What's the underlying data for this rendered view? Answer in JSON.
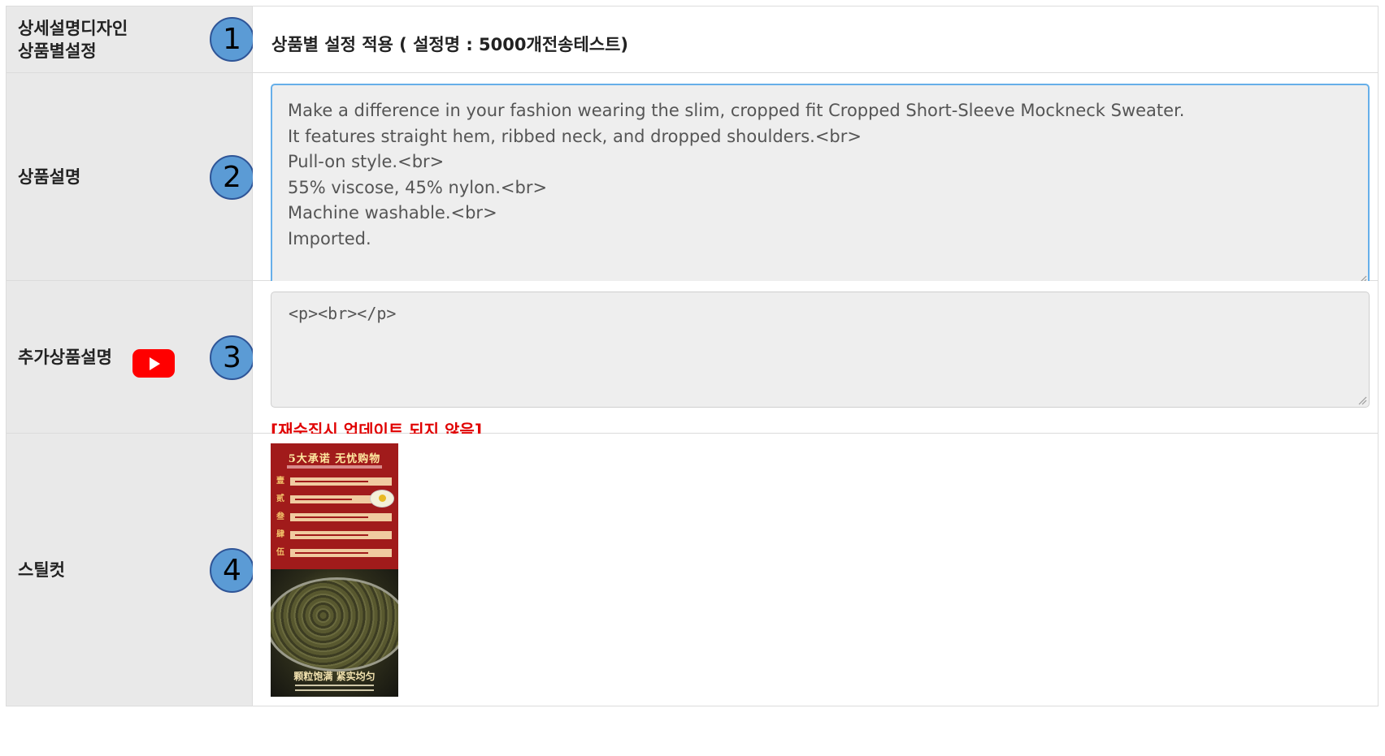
{
  "rows": {
    "design": {
      "label_line1": "상세설명디자인",
      "label_line2": "상품별설정",
      "badge": "1",
      "value": "상품별 설정 적용 ( 설정명 : 5000개전송테스트)"
    },
    "description": {
      "label": "상품설명",
      "badge": "2",
      "text": "Make a difference in your fashion wearing the slim, cropped fit Cropped Short-Sleeve Mockneck Sweater.\nIt features straight hem, ribbed neck, and dropped shoulders.<br>\nPull-on style.<br>\n55% viscose, 45% nylon.<br>\nMachine washable.<br>\nImported."
    },
    "extra_description": {
      "label": "추가상품설명",
      "badge": "3",
      "icon": "youtube-icon",
      "text": "<p><br></p>",
      "warning": "[재수집시 업데이트 되지 않음]"
    },
    "still_cut": {
      "label": "스틸컷",
      "badge": "4",
      "image_title": "5大承诺 无忧购物",
      "image_numerals": [
        "壹",
        "贰",
        "叁",
        "肆",
        "伍"
      ],
      "image_caption": "颗粒饱满 紧实均匀"
    }
  },
  "colors": {
    "label_bg": "#e9e9e9",
    "badge_fill": "#5b9bd5",
    "badge_border": "#2f5597",
    "focus_border": "#66afe9",
    "warning": "#e00000",
    "youtube_red": "#ff0000"
  }
}
